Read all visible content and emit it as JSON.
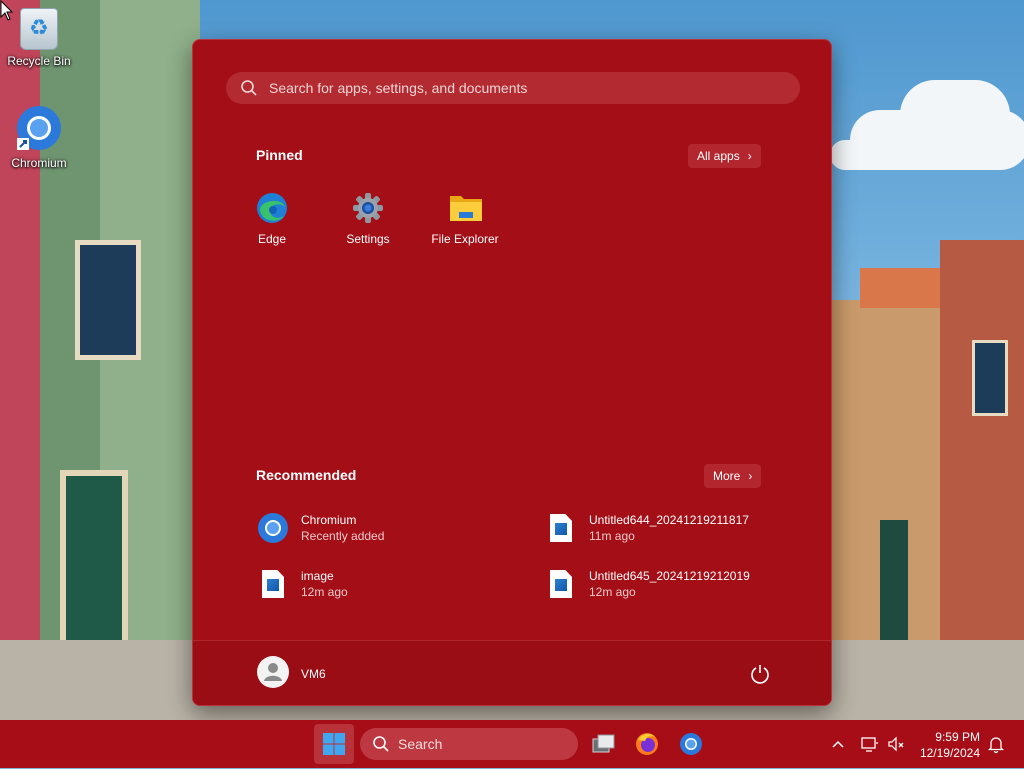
{
  "desktop": {
    "icons": [
      {
        "label": "Recycle Bin",
        "icon": "recycle-bin-icon"
      },
      {
        "label": "Chromium",
        "icon": "chromium-icon"
      }
    ]
  },
  "start_menu": {
    "search_placeholder": "Search for apps, settings, and documents",
    "pinned_title": "Pinned",
    "all_apps_label": "All apps",
    "pinned": [
      {
        "label": "Edge",
        "icon": "edge-icon"
      },
      {
        "label": "Settings",
        "icon": "settings-gear-icon"
      },
      {
        "label": "File Explorer",
        "icon": "folder-icon"
      }
    ],
    "recommended_title": "Recommended",
    "more_label": "More",
    "recommended": [
      {
        "name": "Chromium",
        "sub": "Recently added",
        "icon": "chromium-icon"
      },
      {
        "name": "Untitled644_20241219211817",
        "sub": "11m ago",
        "icon": "image-file-icon"
      },
      {
        "name": "image",
        "sub": "12m ago",
        "icon": "image-file-icon"
      },
      {
        "name": "Untitled645_20241219212019",
        "sub": "12m ago",
        "icon": "image-file-icon"
      }
    ],
    "user": {
      "name": "VM6"
    }
  },
  "taskbar": {
    "search_label": "Search",
    "time": "9:59 PM",
    "date": "12/19/2024"
  },
  "colors": {
    "accent": "#a30e17",
    "taskbar": "#a60d16"
  }
}
